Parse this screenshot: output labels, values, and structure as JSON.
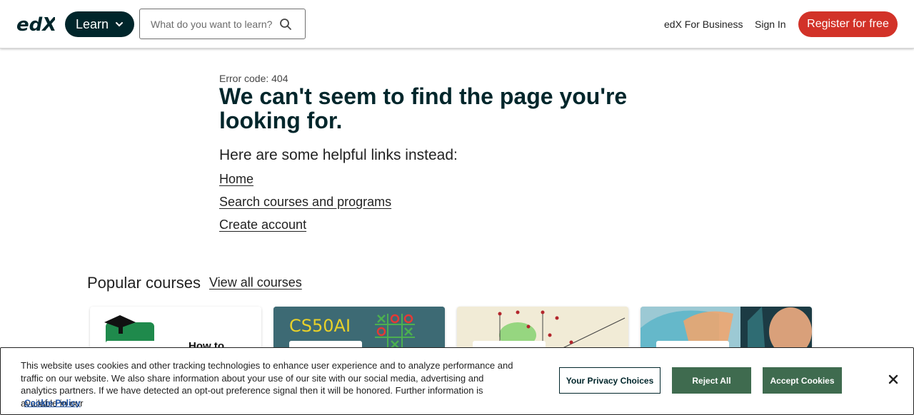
{
  "header": {
    "logo_text": "edX",
    "learn_label": "Learn",
    "search_placeholder": "What do you want to learn?",
    "business_label": "edX For Business",
    "signin_label": "Sign In",
    "register_label": "Register for free"
  },
  "main": {
    "error_code": "Error code: 404",
    "headline": "We can't seem to find the page you're looking for.",
    "helpful_heading": "Here are some helpful links instead:",
    "links": [
      "Home",
      "Search courses and programs",
      "Create account"
    ]
  },
  "popular": {
    "title": "Popular courses",
    "view_all": "View all courses",
    "cards": [
      {
        "text": "How to"
      },
      {
        "text": "CS50AI"
      },
      {
        "text": ""
      },
      {
        "text": ""
      }
    ]
  },
  "cookie": {
    "text": "This website uses cookies and other tracking technologies to enhance user experience and to analyze performance and traffic on our website. We also share information about your use of our site with our social media, advertising and analytics partners. If we have detected an opt-out preference signal then it will be honored. Further information is available in our",
    "policy_link": "Cookie Policy",
    "privacy_button": "Your Privacy Choices",
    "reject_button": "Reject All",
    "accept_button": "Accept Cookies"
  },
  "colors": {
    "brand_dark": "#00262b",
    "register_red": "#d23228",
    "cookie_green": "#3f6b4f"
  },
  "icons": {
    "search": "search-icon",
    "chevron": "chevron-down-icon",
    "close": "close-icon"
  }
}
